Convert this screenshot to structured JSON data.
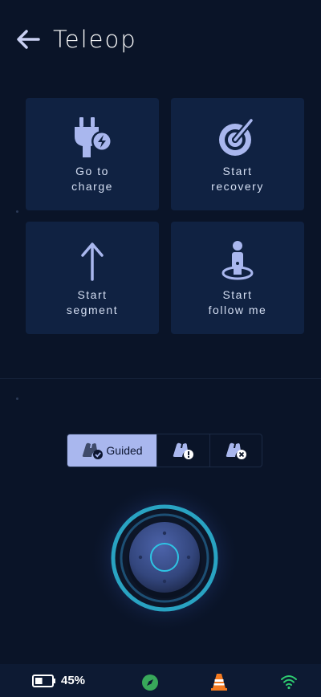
{
  "header": {
    "title": "Teleop",
    "back_icon": "arrow-left-icon"
  },
  "actions": [
    {
      "label": "Go to\ncharge",
      "icon": "plug-charge-icon"
    },
    {
      "label": "Start\nrecovery",
      "icon": "radar-icon"
    },
    {
      "label": "Start\nsegment",
      "icon": "arrow-up-icon"
    },
    {
      "label": "Start\nfollow me",
      "icon": "person-follow-icon"
    }
  ],
  "modes": {
    "active_label": "Guided",
    "items": [
      "guided-mode-icon",
      "warning-mode-icon",
      "manual-mode-icon"
    ]
  },
  "joystick": {
    "icon": "joystick-icon"
  },
  "status": {
    "battery": "45%",
    "battery_level": 0.45,
    "colors": {
      "accent": "#a9b7ee",
      "tile": "#102242",
      "safe": "#38a85a",
      "cone": "#f47a20",
      "wifi": "#2ecc71"
    }
  }
}
